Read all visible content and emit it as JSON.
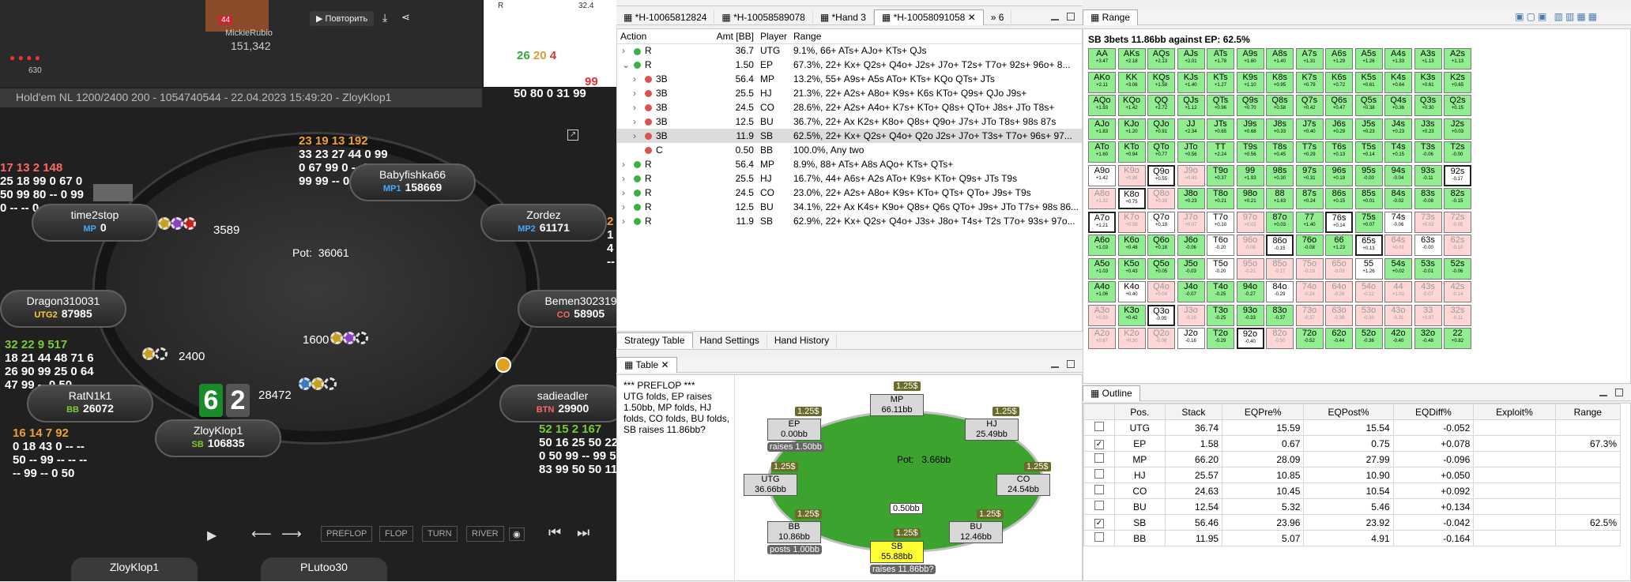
{
  "video": {
    "streamer": "MickieRubio",
    "stack": "151,342",
    "replay": "Повторить",
    "badge": "44",
    "chips": "630"
  },
  "mini": {
    "r1": "R",
    "r2": "32.4",
    "cnt": [
      "26",
      "20",
      "4"
    ],
    "n99": "99",
    "n50": "50 80 0 31 99"
  },
  "poker": {
    "title": "Hold'em NL 1200/2400 200 - 1054740544 - 22.04.2023 15:49:20 - ZloyKlop1",
    "pot_label": "Pot:",
    "pot": "36061",
    "stats": {
      "babyfishka": [
        "23 19 13 192",
        "33 23 27 44 0 99",
        "0 67 99 0 -- 20",
        "99 99 -- 0 0"
      ],
      "timetop": [
        "17 13 2 148",
        "25 18 99 0 67 0",
        "50 99 80 -- 0 99",
        "0 -- -- 0 -- 0"
      ],
      "ratn": [
        "32 22 9 517",
        "18 21 44 48 71 6",
        "26 90 99 25 0 64",
        "47 99 -- 0 50"
      ],
      "zloy": [
        "16 14 7 92",
        "0 18 43 0 -- --",
        "50 -- 99 -- -- --",
        "-- 99 -- 0 50"
      ],
      "sadie": [
        "52 15 2 167",
        "50 16 25 50 22 7",
        "0 50 99 -- 99 50",
        "83 99 50 50 11 5"
      ],
      "zordez": [
        "2",
        "1",
        "4",
        "--"
      ]
    },
    "seats": [
      {
        "name": "Babyfishka66",
        "pos": "MP1",
        "stack": "158669"
      },
      {
        "name": "time2stop",
        "pos": "MP",
        "stack": "0"
      },
      {
        "name": "Zordez",
        "pos": "MP2",
        "stack": "61171"
      },
      {
        "name": "Dragon310031",
        "pos": "UTG2",
        "stack": "87985"
      },
      {
        "name": "Bemen302319",
        "pos": "CO",
        "stack": "58905"
      },
      {
        "name": "RatN1k1",
        "pos": "BB",
        "stack": "26072"
      },
      {
        "name": "sadieadler",
        "pos": "BTN",
        "stack": "29900"
      },
      {
        "name": "ZloyKlop1",
        "pos": "SB",
        "stack": "106835"
      }
    ],
    "bets": {
      "mp": "3589",
      "rat": "2400",
      "bb": "1600",
      "hero": "28472"
    },
    "cards": [
      "6",
      "2"
    ],
    "streets": [
      "PREFLOP",
      "FLOP",
      "TURN",
      "RIVER"
    ],
    "bottom": [
      "ZloyKlop1",
      "PLutoo30"
    ]
  },
  "tabs": [
    "*H-10065812824",
    "*H-10058589078",
    "*Hand 3",
    "*H-10058091058"
  ],
  "tabs_more": "6",
  "action": {
    "headers": [
      "Action",
      "Amt [BB]",
      "Player",
      "Range"
    ],
    "rows": [
      {
        "lvl": 0,
        "arrow": "›",
        "color": "#3cb043",
        "act": "R",
        "amt": "36.7",
        "player": "UTG",
        "range": "9.1%, 66+ ATs+ AJo+ KTs+ QJs"
      },
      {
        "lvl": 0,
        "arrow": "⌄",
        "color": "#3cb043",
        "act": "R",
        "amt": "1.50",
        "player": "EP",
        "range": "67.3%, 22+ Kx+ Q2s+ Q4o+ J2s+ J7o+ T2s+ T7o+ 92s+ 96o+ 8..."
      },
      {
        "lvl": 1,
        "arrow": "›",
        "color": "#d9534f",
        "act": "3B",
        "amt": "56.4",
        "player": "MP",
        "range": "13.2%, 55+ A9s+ A5s ATo+ KTs+ KQo QTs+ JTs"
      },
      {
        "lvl": 1,
        "arrow": "›",
        "color": "#d9534f",
        "act": "3B",
        "amt": "25.5",
        "player": "HJ",
        "range": "21.3%, 22+ A2s+ A8o+ K9s+ K6s KTo+ Q9s+ QJo J9s+"
      },
      {
        "lvl": 1,
        "arrow": "›",
        "color": "#d9534f",
        "act": "3B",
        "amt": "24.5",
        "player": "CO",
        "range": "28.6%, 22+ A2s+ A4o+ K7s+ KTo+ Q8s+ QTo+ J8s+ JTo T8s+"
      },
      {
        "lvl": 1,
        "arrow": "›",
        "color": "#d9534f",
        "act": "3B",
        "amt": "12.5",
        "player": "BU",
        "range": "36.7%, 22+ Ax K2s+ K8o+ Q8s+ Q9o+ J7s+ JTo T8s+ 98s 87s"
      },
      {
        "lvl": 1,
        "arrow": "›",
        "color": "#d9534f",
        "act": "3B",
        "amt": "11.9",
        "player": "SB",
        "range": "62.5%, 22+ Kx+ Q2s+ Q4o+ Q2o J2s+ J7o+ T3s+ T7o+ 96s+ 97...",
        "sel": true
      },
      {
        "lvl": 1,
        "arrow": "",
        "color": "#d9534f",
        "act": "C",
        "amt": "0.50",
        "player": "BB",
        "range": "100.0%, Any two"
      },
      {
        "lvl": 0,
        "arrow": "›",
        "color": "#3cb043",
        "act": "R",
        "amt": "56.4",
        "player": "MP",
        "range": "8.9%, 88+ ATs+ A8s AQo+ KTs+ QTs+"
      },
      {
        "lvl": 0,
        "arrow": "›",
        "color": "#3cb043",
        "act": "R",
        "amt": "25.5",
        "player": "HJ",
        "range": "16.7%, 44+ A6s+ A2s ATo+ K9s+ KTo+ Q9s+ JTs T9s"
      },
      {
        "lvl": 0,
        "arrow": "›",
        "color": "#3cb043",
        "act": "R",
        "amt": "24.5",
        "player": "CO",
        "range": "23.0%, 22+ A2s+ A8o+ K9s+ KTo+ QTs+ QTo+ J9s+ T9s"
      },
      {
        "lvl": 0,
        "arrow": "›",
        "color": "#3cb043",
        "act": "R",
        "amt": "12.5",
        "player": "BU",
        "range": "34.1%, 22+ Ax K4s+ K9o+ Q8s+ Q6s QTo+ J9s+ JTo T7s+ 98s 86..."
      },
      {
        "lvl": 0,
        "arrow": "›",
        "color": "#3cb043",
        "act": "R",
        "amt": "11.9",
        "player": "SB",
        "range": "62.9%, 22+ Kx+ Q2s+ Q4o+ J3s+ J8o+ T4s+ T2s T7o+ 93s+ 97o..."
      }
    ]
  },
  "bottom_tabs": [
    "Strategy Table",
    "Hand Settings",
    "Hand History"
  ],
  "table_panel": {
    "title": "Table",
    "history": "*** PREFLOP ***\nUTG folds, EP raises 1.50bb, MP folds, HJ folds, CO folds, BU folds, SB raises 11.86bb?",
    "pot_label": "Pot:",
    "pot": "3.66bb",
    "center": "0.50bb",
    "seats": [
      {
        "id": "mp",
        "name": "MP",
        "stack": "66.11bb",
        "tag": "1.25$"
      },
      {
        "id": "hj",
        "name": "HJ",
        "stack": "25.49bb",
        "tag": "1.25$"
      },
      {
        "id": "co",
        "name": "CO",
        "stack": "24.54bb",
        "tag": "1.25$"
      },
      {
        "id": "bu",
        "name": "BU",
        "stack": "12.46bb",
        "tag": "1.25$"
      },
      {
        "id": "sb",
        "name": "SB",
        "stack": "55.88bb",
        "tag": "1.25$",
        "note": "raises 11.86bb?"
      },
      {
        "id": "bb",
        "name": "BB",
        "stack": "10.86bb",
        "tag": "1.25$",
        "note": "posts 1.00bb"
      },
      {
        "id": "utg",
        "name": "UTG",
        "stack": "36.66bb",
        "tag": "1.25$"
      },
      {
        "id": "ep",
        "name": "EP",
        "stack": "0.00bb",
        "tag": "1.25$",
        "note": "raises 1.50bb"
      }
    ]
  },
  "range_panel": {
    "title": "Range",
    "subtitle": "SB 3bets 11.86bb against EP: 62.5%",
    "cells": [
      [
        "AA",
        "+3.47"
      ],
      [
        "AKs",
        "+2.18"
      ],
      [
        "AQs",
        "+2.13"
      ],
      [
        "AJs",
        "+2.01"
      ],
      [
        "ATs",
        "+1.78"
      ],
      [
        "A9s",
        "+1.60"
      ],
      [
        "A8s",
        "+1.40"
      ],
      [
        "A7s",
        "+1.31"
      ],
      [
        "A6s",
        "+1.29"
      ],
      [
        "A5s",
        "+1.26"
      ],
      [
        "A4s",
        "+1.33"
      ],
      [
        "A3s",
        "+1.13"
      ],
      [
        "A2s",
        "+1.13"
      ],
      [
        "AKo",
        "+2.11"
      ],
      [
        "KK",
        "+3.06"
      ],
      [
        "KQs",
        "+1.58"
      ],
      [
        "KJs",
        "+1.40"
      ],
      [
        "KTs",
        "+1.27"
      ],
      [
        "K9s",
        "+1.10"
      ],
      [
        "K8s",
        "+0.95"
      ],
      [
        "K7s",
        "+0.79"
      ],
      [
        "K6s",
        "+0.72"
      ],
      [
        "K5s",
        "+0.61"
      ],
      [
        "K4s",
        "+0.64"
      ],
      [
        "K3s",
        "+0.61"
      ],
      [
        "K2s",
        "+0.65"
      ],
      [
        "AQo",
        "+1.93"
      ],
      [
        "KQo",
        "+1.42"
      ],
      [
        "QQ",
        "+2.72"
      ],
      [
        "QJs",
        "+1.12"
      ],
      [
        "QTs",
        "+0.96"
      ],
      [
        "Q9s",
        "+0.70"
      ],
      [
        "Q8s",
        "+0.58"
      ],
      [
        "Q7s",
        "+0.42"
      ],
      [
        "Q6s",
        "+0.47"
      ],
      [
        "Q5s",
        "+0.38"
      ],
      [
        "Q4s",
        "+0.36"
      ],
      [
        "Q3s",
        "+0.30"
      ],
      [
        "Q2s",
        "+0.15"
      ],
      [
        "AJo",
        "+1.83"
      ],
      [
        "KJo",
        "+1.20"
      ],
      [
        "QJo",
        "+0.91"
      ],
      [
        "JJ",
        "+2.34"
      ],
      [
        "JTs",
        "+0.65"
      ],
      [
        "J9s",
        "+0.68"
      ],
      [
        "J8s",
        "+0.33"
      ],
      [
        "J7s",
        "+0.40"
      ],
      [
        "J6s",
        "+0.29"
      ],
      [
        "J5s",
        "+0.23"
      ],
      [
        "J4s",
        "+0.23"
      ],
      [
        "J3s",
        "+0.23"
      ],
      [
        "J2s",
        "+0.03"
      ],
      [
        "ATo",
        "+1.60"
      ],
      [
        "KTo",
        "+0.94"
      ],
      [
        "QTo",
        "+0.77"
      ],
      [
        "JTo",
        "+0.56"
      ],
      [
        "TT",
        "+2.24"
      ],
      [
        "T9s",
        "+0.56"
      ],
      [
        "T8s",
        "+0.45"
      ],
      [
        "T7s",
        "+0.29"
      ],
      [
        "T6s",
        "+0.13"
      ],
      [
        "T5s",
        "+0.14"
      ],
      [
        "T4s",
        "+0.15"
      ],
      [
        "T3s",
        "-0.06"
      ],
      [
        "T2s",
        "-0.00"
      ],
      [
        "A9o",
        "+1.42"
      ],
      [
        "K9o",
        "+0.86"
      ],
      [
        "Q9o",
        "+0.55"
      ],
      [
        "J9o",
        "+0.43"
      ],
      [
        "T9o",
        "+0.37"
      ],
      [
        "99",
        "+1.93"
      ],
      [
        "98s",
        "+0.30"
      ],
      [
        "97s",
        "+0.31"
      ],
      [
        "96s",
        "+0.19"
      ],
      [
        "95s",
        "-0.00"
      ],
      [
        "94s",
        "-0.04"
      ],
      [
        "93s",
        "-0.11"
      ],
      [
        "92s",
        "-0.17"
      ],
      [
        "A8o",
        "+1.32"
      ],
      [
        "K8o",
        "+0.75"
      ],
      [
        "Q8o",
        "+0.38"
      ],
      [
        "J8o",
        "+0.23"
      ],
      [
        "T8o",
        "+0.21"
      ],
      [
        "98o",
        "+0.21"
      ],
      [
        "88",
        "+1.63"
      ],
      [
        "87s",
        "+0.24"
      ],
      [
        "86s",
        "+0.15"
      ],
      [
        "85s",
        "+0.01"
      ],
      [
        "84s",
        "-0.02"
      ],
      [
        "83s",
        "-0.08"
      ],
      [
        "82s",
        "-0.15"
      ],
      [
        "A7o",
        "+1.21"
      ],
      [
        "K7o",
        "+0.59"
      ],
      [
        "Q7o",
        "+0.19"
      ],
      [
        "J7o",
        "+0.07"
      ],
      [
        "T7o",
        "+0.10"
      ],
      [
        "97o",
        "+0.02"
      ],
      [
        "87o",
        "+0.03"
      ],
      [
        "77",
        "+1.40"
      ],
      [
        "76s",
        "+0.14"
      ],
      [
        "75s",
        "+0.07"
      ],
      [
        "74s",
        "-0.06"
      ],
      [
        "73s",
        "+0.02"
      ],
      [
        "72s",
        "-0.05"
      ],
      [
        "A6o",
        "+1.03"
      ],
      [
        "K6o",
        "+0.48"
      ],
      [
        "Q6o",
        "+0.16"
      ],
      [
        "J6o",
        "-0.06"
      ],
      [
        "T6o",
        "-0.20"
      ],
      [
        "96o",
        "-0.08"
      ],
      [
        "86o",
        "-0.15"
      ],
      [
        "76o",
        "-0.08"
      ],
      [
        "66",
        "+1.23"
      ],
      [
        "65s",
        "+0.13"
      ],
      [
        "64s",
        "+0.01"
      ],
      [
        "63s",
        "-0.00"
      ],
      [
        "62s",
        "-0.10"
      ],
      [
        "A5o",
        "+1.03"
      ],
      [
        "K5o",
        "+0.43"
      ],
      [
        "Q5o",
        "+0.05"
      ],
      [
        "J5o",
        "-0.03"
      ],
      [
        "T5o",
        "-0.20"
      ],
      [
        "95o",
        "-0.21"
      ],
      [
        "85o",
        "-0.17"
      ],
      [
        "75o",
        "-0.19"
      ],
      [
        "65o",
        "-0.03"
      ],
      [
        "55",
        "+1.26"
      ],
      [
        "54s",
        "+0.02"
      ],
      [
        "53s",
        "-0.01"
      ],
      [
        "52s",
        "-0.06"
      ],
      [
        "A4o",
        "+1.06"
      ],
      [
        "K4o",
        "+0.40"
      ],
      [
        "Q4o",
        "+0.04"
      ],
      [
        "J4o",
        "-0.07"
      ],
      [
        "T4o",
        "-0.25"
      ],
      [
        "94o",
        "-0.27"
      ],
      [
        "84o",
        "-0.29"
      ],
      [
        "74o",
        "-0.24"
      ],
      [
        "64o",
        "-0.26"
      ],
      [
        "54o",
        "-0.12"
      ],
      [
        "44",
        "+1.02"
      ],
      [
        "43s",
        "-0.07"
      ],
      [
        "42s",
        "-0.14"
      ],
      [
        "A3o",
        "+0.93"
      ],
      [
        "K3o",
        "+0.42"
      ],
      [
        "Q3o",
        "-0.05"
      ],
      [
        "J3o",
        "-0.16"
      ],
      [
        "T3o",
        "-0.25"
      ],
      [
        "93o",
        "-0.33"
      ],
      [
        "83o",
        "-0.37"
      ],
      [
        "73o",
        "-0.37"
      ],
      [
        "63o",
        "-0.38"
      ],
      [
        "53o",
        "-0.30"
      ],
      [
        "43o",
        "-0.31"
      ],
      [
        "33",
        "+0.97"
      ],
      [
        "32s",
        "-0.11"
      ],
      [
        "A2o",
        "+0.87"
      ],
      [
        "K2o",
        "+0.30"
      ],
      [
        "Q2o",
        "-0.06"
      ],
      [
        "J2o",
        "-0.16"
      ],
      [
        "T2o",
        "-0.29"
      ],
      [
        "92o",
        "-0.40"
      ],
      [
        "82o",
        "-0.50"
      ],
      [
        "72o",
        "-0.52"
      ],
      [
        "62o",
        "-0.44"
      ],
      [
        "52o",
        "-0.36"
      ],
      [
        "42o",
        "-0.40"
      ],
      [
        "32o",
        "-0.48"
      ],
      [
        "22",
        "+0.82"
      ]
    ],
    "state": "FFFFFFFFFFFFFFFFFFFFFFFFFFFFFFFFFFFFFFFFFFFFFFFFFFFFFFFFFFFFFFFFFWpSpFFFFFFFFSpSpFFFFFFFFFFSpWpWpFFSFWppFFFFWpSFFSpWpFFFFWppppWFFFFWpFFFWpppppppFSpFFFpppppppppWFSp"
  },
  "outline": {
    "title": "Outline",
    "headers": [
      "",
      "Pos.",
      "Stack",
      "EQPre%",
      "EQPost%",
      "EQDiff%",
      "Exploit%",
      "Range"
    ],
    "rows": [
      {
        "chk": false,
        "pos": "UTG",
        "stack": "36.74",
        "pre": "15.59",
        "post": "15.54",
        "diff": "-0.052",
        "exp": "",
        "rng": ""
      },
      {
        "chk": true,
        "pos": "EP",
        "stack": "1.58",
        "pre": "0.67",
        "post": "0.75",
        "diff": "+0.078",
        "exp": "",
        "rng": "67.3%"
      },
      {
        "chk": false,
        "pos": "MP",
        "stack": "66.20",
        "pre": "28.09",
        "post": "27.99",
        "diff": "-0.096",
        "exp": "",
        "rng": ""
      },
      {
        "chk": false,
        "pos": "HJ",
        "stack": "25.57",
        "pre": "10.85",
        "post": "10.90",
        "diff": "+0.050",
        "exp": "",
        "rng": ""
      },
      {
        "chk": false,
        "pos": "CO",
        "stack": "24.63",
        "pre": "10.45",
        "post": "10.54",
        "diff": "+0.092",
        "exp": "",
        "rng": ""
      },
      {
        "chk": false,
        "pos": "BU",
        "stack": "12.54",
        "pre": "5.32",
        "post": "5.46",
        "diff": "+0.134",
        "exp": "",
        "rng": ""
      },
      {
        "chk": true,
        "pos": "SB",
        "stack": "56.46",
        "pre": "23.96",
        "post": "23.92",
        "diff": "-0.042",
        "exp": "",
        "rng": "62.5%"
      },
      {
        "chk": false,
        "pos": "BB",
        "stack": "11.95",
        "pre": "5.07",
        "post": "4.91",
        "diff": "-0.164",
        "exp": "",
        "rng": ""
      }
    ]
  }
}
